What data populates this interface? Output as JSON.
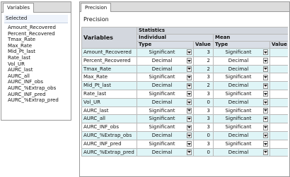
{
  "variables_panel": {
    "tab_label": "Variables",
    "section_label": "Selected",
    "items": [
      "Amount_Recovered",
      "Percent_Recovered",
      "Tmax_Rate",
      "Max_Rate",
      "Mid_Pt_last",
      "Rate_last",
      "Vol_UR",
      "AURC_last",
      "AURC_all",
      "AURC_INF_obs",
      "AURC_%Extrap_obs",
      "AURC_INF_pred",
      "AURC_%Extrap_pred"
    ]
  },
  "precision_panel": {
    "tab_label": "Precision",
    "title": "Precision",
    "table": {
      "header_variables": "Variables",
      "header_statistics": "Statistics",
      "group_individual": "Individual",
      "group_mean": "Mean",
      "col_type": "Type",
      "col_value": "Value",
      "rows": [
        {
          "name": "Amount_Recovered",
          "ind_type": "Significant",
          "ind_value": "3",
          "mean_type": "Significant",
          "mean_value": "3"
        },
        {
          "name": "Percent_Recovered",
          "ind_type": "Decimal",
          "ind_value": "2",
          "mean_type": "Decimal",
          "mean_value": "2"
        },
        {
          "name": "Tmax_Rate",
          "ind_type": "Decimal",
          "ind_value": "2",
          "mean_type": "Decimal",
          "mean_value": "2"
        },
        {
          "name": "Max_Rate",
          "ind_type": "Significant",
          "ind_value": "3",
          "mean_type": "Significant",
          "mean_value": "3"
        },
        {
          "name": "Mid_Pt_last",
          "ind_type": "Decimal",
          "ind_value": "2",
          "mean_type": "Decimal",
          "mean_value": "2"
        },
        {
          "name": "Rate_last",
          "ind_type": "Significant",
          "ind_value": "3",
          "mean_type": "Significant",
          "mean_value": "3"
        },
        {
          "name": "Vol_UR",
          "ind_type": "Decimal",
          "ind_value": "0",
          "mean_type": "Decimal",
          "mean_value": "0"
        },
        {
          "name": "AURC_last",
          "ind_type": "Significant",
          "ind_value": "3",
          "mean_type": "Significant",
          "mean_value": "3"
        },
        {
          "name": "AURC_all",
          "ind_type": "Significant",
          "ind_value": "3",
          "mean_type": "Significant",
          "mean_value": "3"
        },
        {
          "name": "AURC_INF_obs",
          "ind_type": "Significant",
          "ind_value": "3",
          "mean_type": "Significant",
          "mean_value": "3"
        },
        {
          "name": "AURC_%Extrap_obs",
          "ind_type": "Decimal",
          "ind_value": "0",
          "mean_type": "Decimal",
          "mean_value": "0"
        },
        {
          "name": "AURC_INF_pred",
          "ind_type": "Significant",
          "ind_value": "3",
          "mean_type": "Significant",
          "mean_value": "3"
        },
        {
          "name": "AURC_%Extrap_pred",
          "ind_type": "Decimal",
          "ind_value": "0",
          "mean_type": "Decimal",
          "mean_value": "0"
        }
      ]
    }
  },
  "icons": {
    "dropdown": "chevron-down-icon"
  },
  "colors": {
    "row_alt": "#dff5f7",
    "header_bg": "#d9dee6",
    "border": "#b9b9b9"
  }
}
